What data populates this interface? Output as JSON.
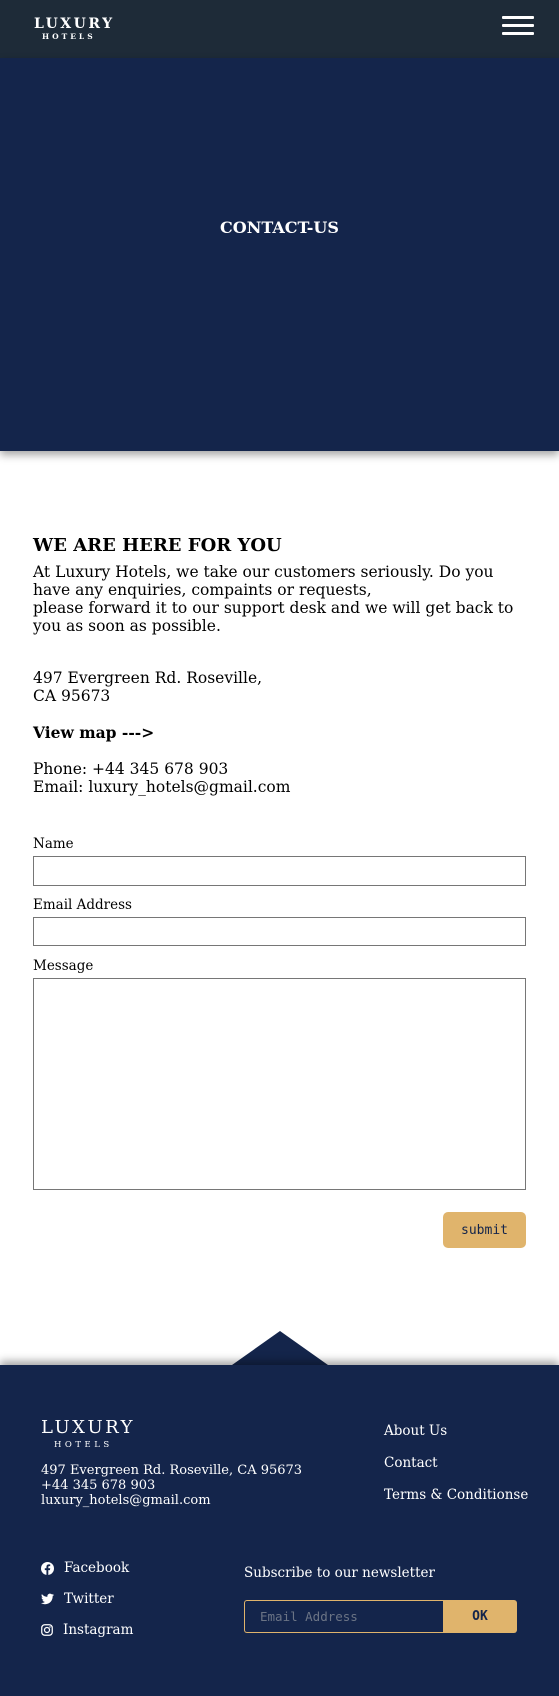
{
  "header": {
    "logo_main": "LUXURY",
    "logo_sub": "HOTELS",
    "menu_icon": "hamburger-menu-icon"
  },
  "hero": {
    "title": "CONTACT-US"
  },
  "intro": {
    "heading": "WE ARE HERE FOR YOU",
    "line1": "At Luxury Hotels, we take our customers seriously. Do you have any enquiries, compaints or requests,",
    "line2": "please forward it to our support desk and we will get back to you as soon as possible."
  },
  "location": {
    "address_line1": "497 Evergreen Rd. Roseville,",
    "address_line2": "CA 95673",
    "view_map": "View map --->"
  },
  "contact_info": {
    "phone": "Phone: +44 345 678 903",
    "email": "Email: luxury_hotels@gmail.com"
  },
  "form": {
    "name_label": "Name",
    "name_value": "",
    "email_label": "Email Address",
    "email_value": "",
    "message_label": "Message",
    "message_value": "",
    "submit_label": "submit"
  },
  "footer": {
    "logo_main": "LUXURY",
    "logo_sub": "HOTELS",
    "address": "497 Evergreen Rd. Roseville, CA 95673",
    "phone": "+44 345 678 903",
    "email": "luxury_hotels@gmail.com",
    "links": [
      "About Us",
      "Contact",
      "Terms & Conditionse"
    ],
    "social": [
      {
        "label": "Facebook",
        "icon": "facebook-icon"
      },
      {
        "label": "Twitter",
        "icon": "twitter-icon"
      },
      {
        "label": "Instagram",
        "icon": "instagram-icon"
      }
    ],
    "newsletter_label": "Subscribe to our newsletter",
    "newsletter_placeholder": "Email Address",
    "newsletter_button": "OK"
  },
  "colors": {
    "header_bg": "#1e2b38",
    "navy": "#14254b",
    "accent_gold": "#e0b46c"
  }
}
